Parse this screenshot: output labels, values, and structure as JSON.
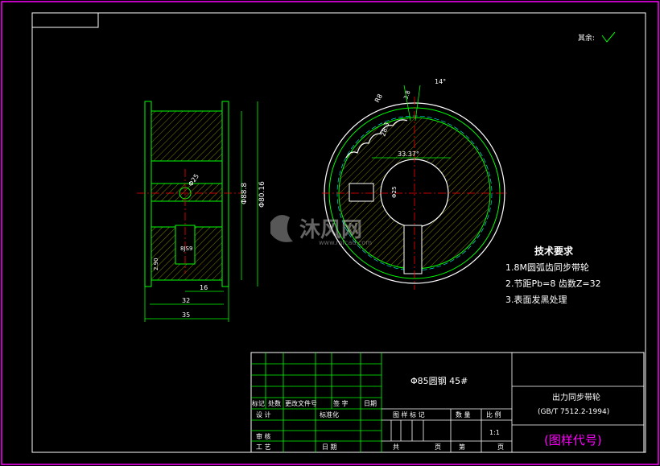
{
  "surface_finish": {
    "label": "其余:"
  },
  "side_view": {
    "dims": {
      "od1": "Φ80.16",
      "od2": "Φ88.8",
      "bore": "Φ25",
      "keyway": "8JS9",
      "wall": "2.90",
      "width_inner": "16",
      "width_mid": "32",
      "width_total": "35"
    }
  },
  "front_view": {
    "dims": {
      "teeth_r": "R8",
      "tooth_depth": "3.8",
      "tooth_angle": "14°",
      "keyway_depth": "28.3",
      "bore": "Φ25",
      "chord": "33.37°"
    }
  },
  "tech_requirements": {
    "title": "技术要求",
    "items": [
      "1.8M圆弧齿同步带轮",
      "2.节距Pb=8 齿数Z=32",
      "3.表面发黑处理"
    ]
  },
  "watermark": {
    "text": "沐风网",
    "url": "www.mfcad.com"
  },
  "title_block": {
    "material": "Φ85圆钢 45#",
    "part_name": "出力同步带轮",
    "standard": "(GB/T 7512.2-1994)",
    "drawing_code": "(图样代号)",
    "scale": "1:1",
    "rev_headers": [
      "标记",
      "处数",
      "更改文件号",
      "签 字",
      "日期"
    ],
    "row_design": "设 计",
    "row_standard": "标准化",
    "row_check": "审 核",
    "row_process": "工 艺",
    "row_date": "日 期",
    "stage_label": "图 样 标 记",
    "qty_label": "数 量",
    "scale_label": "比 例",
    "sheets_label": "共",
    "page_label": "页",
    "sheet_label": "第",
    "page_label2": "页"
  },
  "colors": {
    "frame": "#ff00ff",
    "border": "#ffffff",
    "geometry": "#00ff00",
    "center": "#ff0000",
    "hatch": "#808000",
    "text": "#ffffff",
    "dim": "#00ff00",
    "title_code": "#ff00ff"
  }
}
